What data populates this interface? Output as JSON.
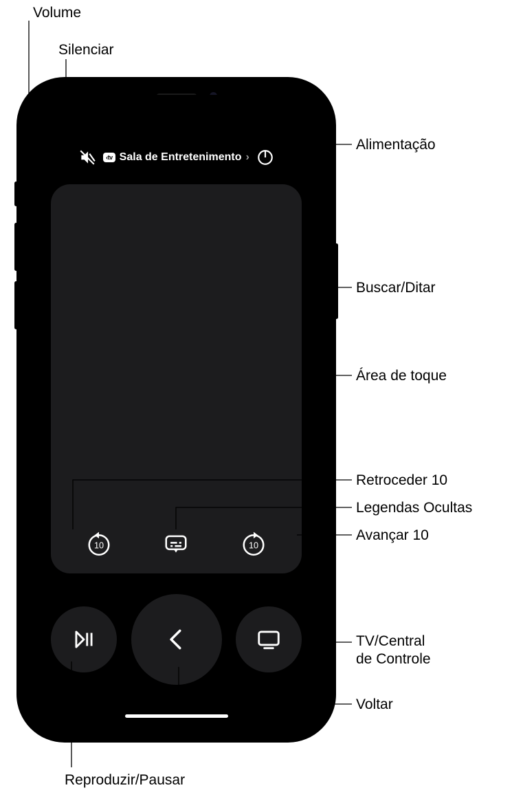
{
  "callouts": {
    "volume": "Volume",
    "mute": "Silenciar",
    "power": "Alimentação",
    "search": "Buscar/Ditar",
    "touch": "Área de toque",
    "skipback": "Retroceder 10",
    "captions": "Legendas Ocultas",
    "skipfwd": "Avançar 10",
    "tvcc_l1": "TV/Central",
    "tvcc_l2": "de Controle",
    "back": "Voltar",
    "playpause": "Reproduzir/Pausar"
  },
  "header": {
    "atv_badge": "‹tv",
    "device_name": "Sala de Entretenimento"
  }
}
